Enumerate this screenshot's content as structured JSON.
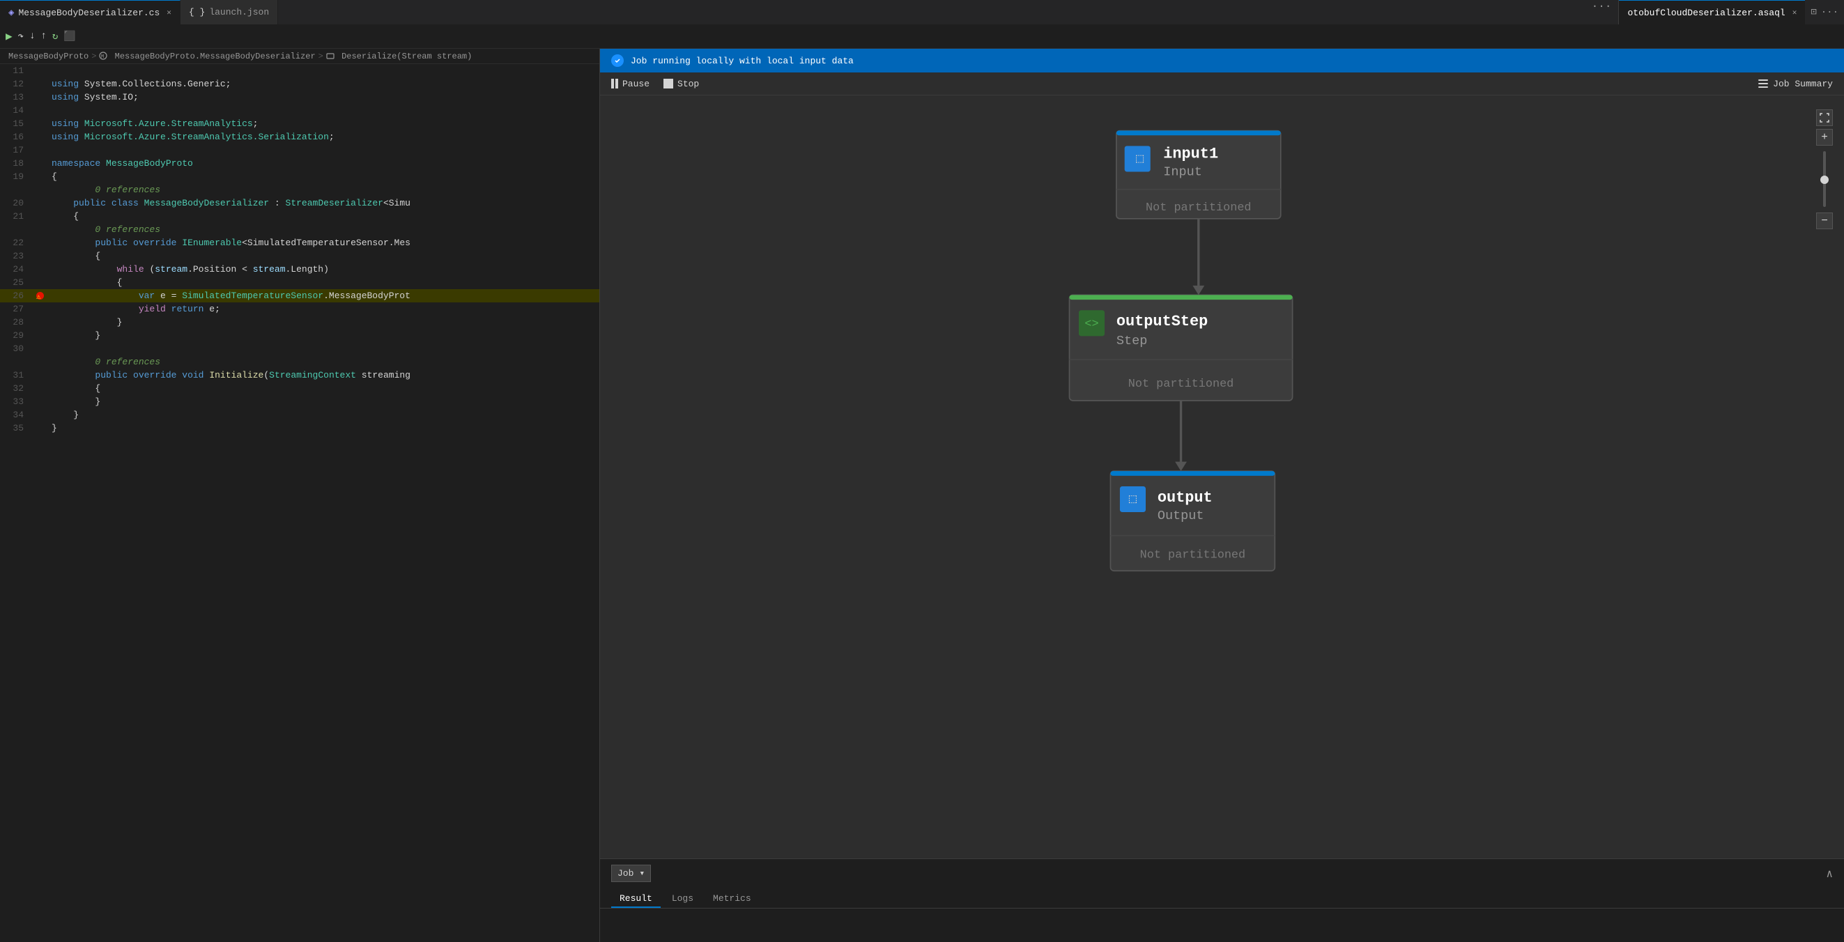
{
  "tabs_left": [
    {
      "id": "cs-tab",
      "label": "MessageBodyDeserializer.cs",
      "icon": "cs",
      "active": true,
      "closable": true
    },
    {
      "id": "json-tab",
      "label": "launch.json",
      "icon": "json",
      "active": false,
      "closable": false
    }
  ],
  "tabs_left_more": "···",
  "tabs_right": [
    {
      "id": "asaql-tab",
      "label": "otobufCloudDeserializer.asaql",
      "active": true,
      "closable": true
    }
  ],
  "tabs_right_more": "···",
  "breadcrumb": {
    "parts": [
      "MessageBodyProto",
      "MessageBodyProto.MessageBodyDeserializer",
      "Deserialize(Stream stream)"
    ],
    "separators": [
      ">",
      ">"
    ]
  },
  "code_lines": [
    {
      "num": 11,
      "content": "",
      "tokens": []
    },
    {
      "num": 12,
      "content": "using System.Collections.Generic;",
      "tokens": [
        {
          "t": "kw",
          "v": "using"
        },
        {
          "t": "",
          "v": " System.Collections.Generic;"
        }
      ]
    },
    {
      "num": 13,
      "content": "using System.IO;",
      "tokens": [
        {
          "t": "kw",
          "v": "using"
        },
        {
          "t": "",
          "v": " System.IO;"
        }
      ]
    },
    {
      "num": 14,
      "content": "",
      "tokens": []
    },
    {
      "num": 15,
      "content": "using Microsoft.Azure.StreamAnalytics;",
      "tokens": [
        {
          "t": "kw",
          "v": "using"
        },
        {
          "t": "",
          "v": " "
        },
        {
          "t": "ns",
          "v": "Microsoft.Azure.StreamAnalytics"
        },
        {
          "t": "",
          "v": ";"
        }
      ]
    },
    {
      "num": 16,
      "content": "using Microsoft.Azure.StreamAnalytics.Serialization;",
      "tokens": [
        {
          "t": "kw",
          "v": "using"
        },
        {
          "t": "",
          "v": " "
        },
        {
          "t": "ns",
          "v": "Microsoft.Azure.StreamAnalytics.Serialization"
        },
        {
          "t": "",
          "v": ";"
        }
      ]
    },
    {
      "num": 17,
      "content": "",
      "tokens": []
    },
    {
      "num": 18,
      "content": "namespace MessageBodyProto",
      "tokens": [
        {
          "t": "kw",
          "v": "namespace"
        },
        {
          "t": "",
          "v": " "
        },
        {
          "t": "ns",
          "v": "MessageBodyProto"
        }
      ]
    },
    {
      "num": 19,
      "content": "{",
      "tokens": [
        {
          "t": "",
          "v": "{"
        }
      ]
    },
    {
      "num": 20,
      "content": "        0 references",
      "tokens": [
        {
          "t": "ref-comment",
          "v": "        0 references"
        }
      ],
      "ref": true
    },
    {
      "num": 20,
      "content": "    public class MessageBodyDeserializer : StreamDeserializer<Simu",
      "tokens": [
        {
          "t": "",
          "v": "    "
        },
        {
          "t": "kw",
          "v": "public"
        },
        {
          "t": "",
          "v": " "
        },
        {
          "t": "kw",
          "v": "class"
        },
        {
          "t": "",
          "v": " "
        },
        {
          "t": "type",
          "v": "MessageBodyDeserializer"
        },
        {
          "t": "",
          "v": " : "
        },
        {
          "t": "type",
          "v": "StreamDeserializer"
        },
        {
          "t": "",
          "v": "<Simu"
        }
      ]
    },
    {
      "num": 21,
      "content": "    {",
      "tokens": [
        {
          "t": "",
          "v": "    {"
        }
      ]
    },
    {
      "num": 22,
      "content": "        0 references",
      "tokens": [
        {
          "t": "ref-comment",
          "v": "        0 references"
        }
      ],
      "ref": true
    },
    {
      "num": 22,
      "content": "        public override IEnumerable<SimulatedTemperatureSensor.Mes",
      "tokens": [
        {
          "t": "",
          "v": "        "
        },
        {
          "t": "kw",
          "v": "public"
        },
        {
          "t": "",
          "v": " "
        },
        {
          "t": "kw",
          "v": "override"
        },
        {
          "t": "",
          "v": " "
        },
        {
          "t": "type",
          "v": "IEnumerable"
        },
        {
          "t": "",
          "v": "<SimulatedTemperatureSensor.Mes"
        }
      ]
    },
    {
      "num": 23,
      "content": "        {",
      "tokens": [
        {
          "t": "",
          "v": "        {"
        }
      ]
    },
    {
      "num": 24,
      "content": "            while (stream.Position < stream.Length)",
      "tokens": [
        {
          "t": "",
          "v": "            "
        },
        {
          "t": "kw2",
          "v": "while"
        },
        {
          "t": "",
          "v": " ("
        },
        {
          "t": "ident",
          "v": "stream"
        },
        {
          "t": "",
          "v": ".Position < "
        },
        {
          "t": "ident",
          "v": "stream"
        },
        {
          "t": "",
          "v": ".Length)"
        }
      ]
    },
    {
      "num": 25,
      "content": "            {",
      "tokens": [
        {
          "t": "",
          "v": "            {"
        }
      ]
    },
    {
      "num": 26,
      "content": "                var e = SimulatedTemperatureSensor.MessageBodyProt",
      "tokens": [
        {
          "t": "",
          "v": "                "
        },
        {
          "t": "kw",
          "v": "var"
        },
        {
          "t": "",
          "v": " e = "
        },
        {
          "t": "ns",
          "v": "SimulatedTemperatureSensor"
        },
        {
          "t": "",
          "v": ".MessageBodyProt"
        }
      ],
      "breakpoint": true,
      "debug": true,
      "highlight": true
    },
    {
      "num": 27,
      "content": "                yield return e;",
      "tokens": [
        {
          "t": "",
          "v": "                "
        },
        {
          "t": "kw2",
          "v": "yield"
        },
        {
          "t": "",
          "v": " "
        },
        {
          "t": "kw",
          "v": "return"
        },
        {
          "t": "",
          "v": " e;"
        }
      ]
    },
    {
      "num": 28,
      "content": "            }",
      "tokens": [
        {
          "t": "",
          "v": "            }"
        }
      ]
    },
    {
      "num": 29,
      "content": "        }",
      "tokens": [
        {
          "t": "",
          "v": "        }"
        }
      ]
    },
    {
      "num": 30,
      "content": "",
      "tokens": []
    },
    {
      "num": 31,
      "content": "        0 references",
      "tokens": [
        {
          "t": "ref-comment",
          "v": "        0 references"
        }
      ],
      "ref": true
    },
    {
      "num": 31,
      "content": "        public override void Initialize(StreamingContext streaming",
      "tokens": [
        {
          "t": "",
          "v": "        "
        },
        {
          "t": "kw",
          "v": "public"
        },
        {
          "t": "",
          "v": " "
        },
        {
          "t": "kw",
          "v": "override"
        },
        {
          "t": "",
          "v": " "
        },
        {
          "t": "kw",
          "v": "void"
        },
        {
          "t": "",
          "v": " "
        },
        {
          "t": "method",
          "v": "Initialize"
        },
        {
          "t": "",
          "v": "("
        },
        {
          "t": "type",
          "v": "StreamingContext"
        },
        {
          "t": "",
          "v": " streaming"
        }
      ]
    },
    {
      "num": 32,
      "content": "        {",
      "tokens": [
        {
          "t": "",
          "v": "        {"
        }
      ]
    },
    {
      "num": 33,
      "content": "        }",
      "tokens": [
        {
          "t": "",
          "v": "        }"
        }
      ]
    },
    {
      "num": 34,
      "content": "    }",
      "tokens": [
        {
          "t": "",
          "v": "    }"
        }
      ]
    },
    {
      "num": 35,
      "content": "}",
      "tokens": [
        {
          "t": "",
          "v": "}"
        }
      ]
    }
  ],
  "right_panel": {
    "job_banner": {
      "text": "Job running locally with local input data"
    },
    "controls": {
      "pause_label": "Pause",
      "stop_label": "Stop",
      "job_summary_label": "Job Summary"
    },
    "diagram": {
      "nodes": [
        {
          "id": "input1",
          "type": "input",
          "title": "input1",
          "subtitle": "Input",
          "label": "Not partitioned"
        },
        {
          "id": "outputStep",
          "type": "step",
          "title": "outputStep",
          "subtitle": "Step",
          "label": "Not partitioned"
        },
        {
          "id": "output",
          "type": "output",
          "title": "output",
          "subtitle": "Output",
          "label": "Not partitioned"
        }
      ]
    },
    "zoom_controls": {
      "expand_label": "⤢",
      "plus_label": "+",
      "minus_label": "−"
    },
    "bottom": {
      "job_select_label": "Job",
      "tabs": [
        {
          "id": "result",
          "label": "Result",
          "active": true
        },
        {
          "id": "logs",
          "label": "Logs",
          "active": false
        },
        {
          "id": "metrics",
          "label": "Metrics",
          "active": false
        }
      ]
    }
  }
}
